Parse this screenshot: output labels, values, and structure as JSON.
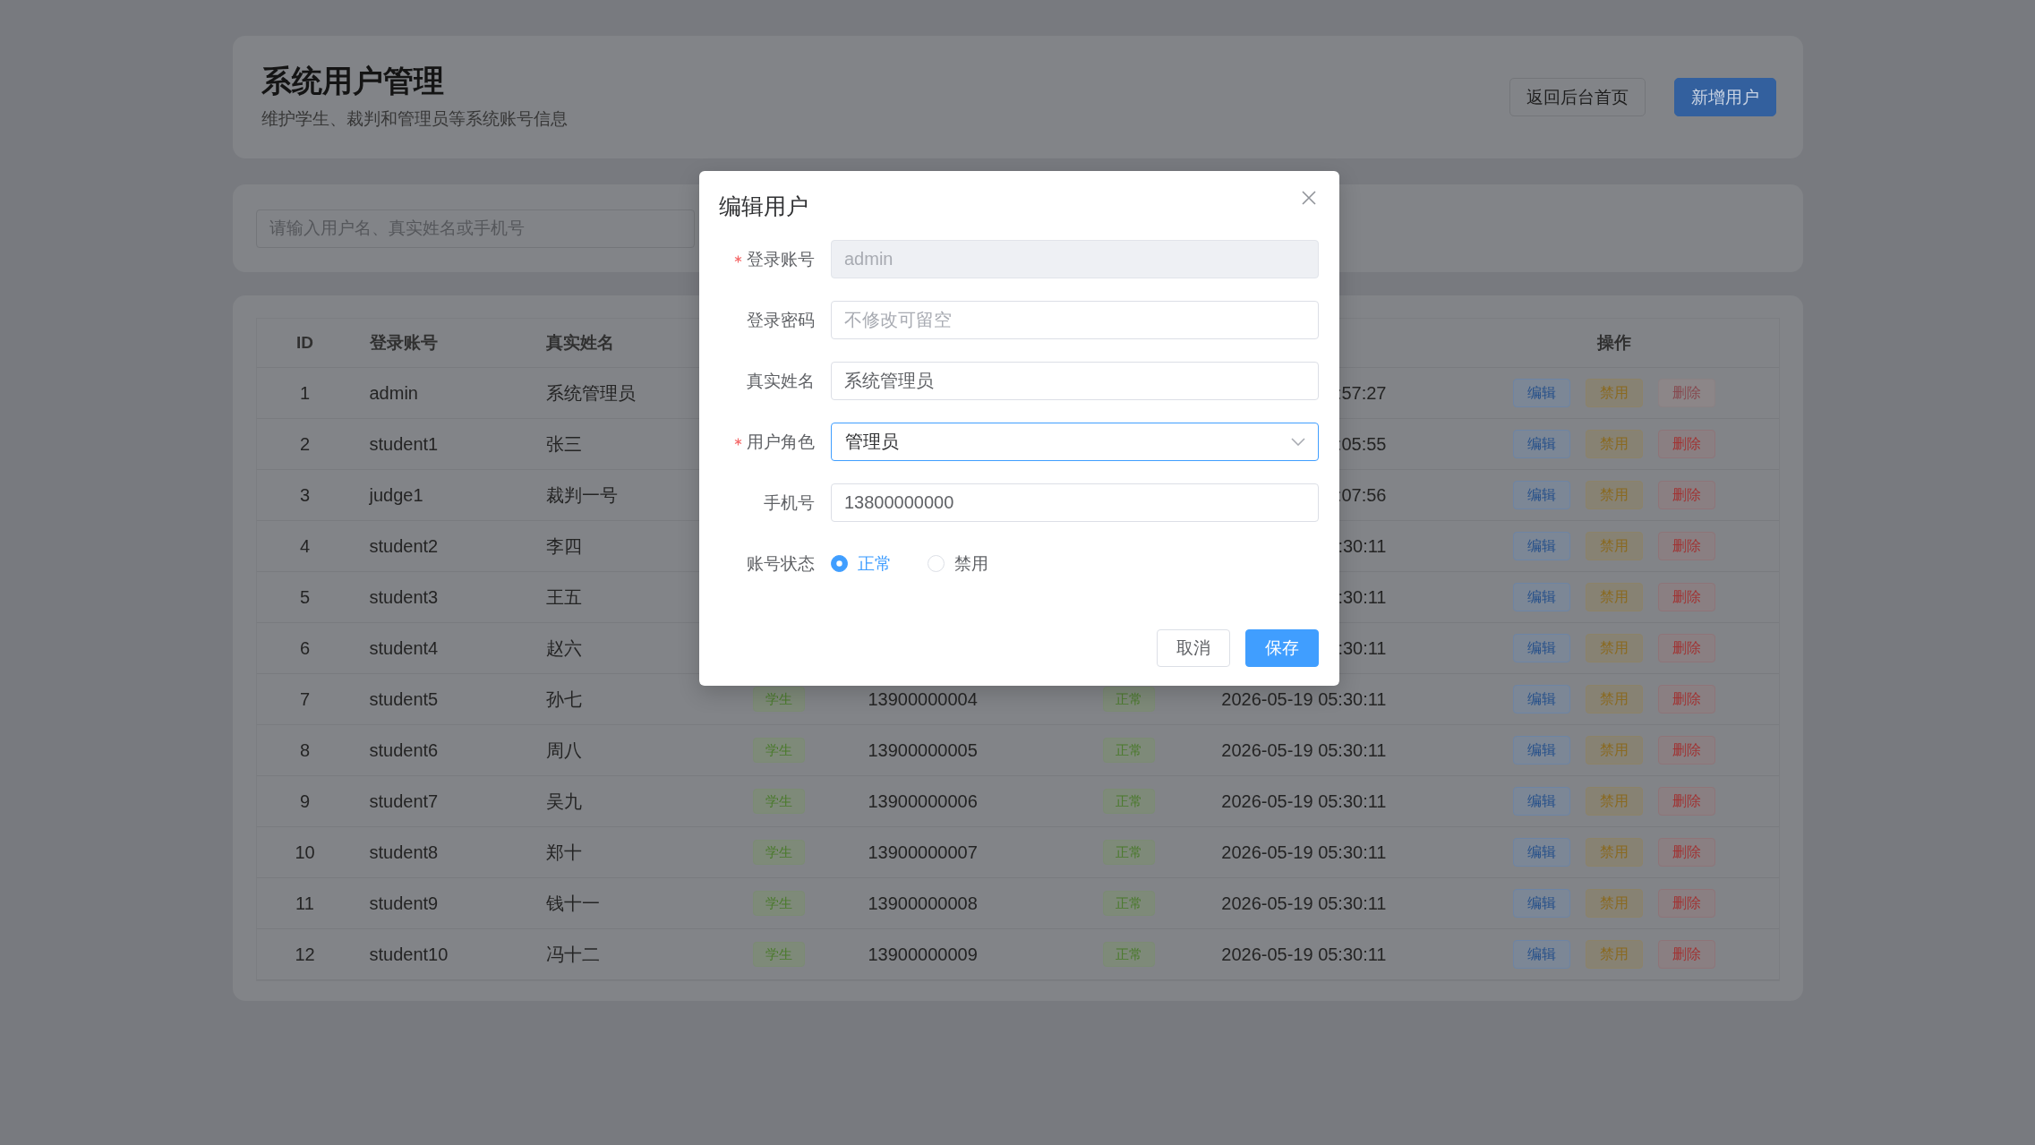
{
  "header": {
    "title": "系统用户管理",
    "subtitle": "维护学生、裁判和管理员等系统账号信息",
    "buttons": [
      {
        "label": "返回后台首页",
        "kind": "back"
      },
      {
        "label": "新增用户",
        "kind": "add"
      }
    ]
  },
  "search": {
    "placeholder": "请输入用户名、真实姓名或手机号"
  },
  "table": {
    "columns": {
      "id": "ID",
      "account": "登录账号",
      "real_name": "真实姓名",
      "actions": "操作"
    },
    "rows": [
      {
        "id": "1",
        "account": "admin",
        "real_name": "系统管理员",
        "column_7": ":57:27",
        "actions": [
          {
            "label": "编辑",
            "kind": "edit",
            "disabled": false
          },
          {
            "label": "禁用",
            "kind": "disable",
            "disabled": false
          },
          {
            "label": "删除",
            "kind": "delete",
            "disabled": true
          }
        ]
      },
      {
        "id": "2",
        "account": "student1",
        "real_name": "张三",
        "column_7": ":05:55",
        "actions": [
          {
            "label": "编辑",
            "kind": "edit",
            "disabled": false
          },
          {
            "label": "禁用",
            "kind": "disable",
            "disabled": false
          },
          {
            "label": "删除",
            "kind": "delete",
            "disabled": false
          }
        ]
      },
      {
        "id": "3",
        "account": "judge1",
        "real_name": "裁判一号",
        "column_7": ":07:56",
        "actions": [
          {
            "label": "编辑",
            "kind": "edit",
            "disabled": false
          },
          {
            "label": "禁用",
            "kind": "disable",
            "disabled": false
          },
          {
            "label": "删除",
            "kind": "delete",
            "disabled": false
          }
        ]
      },
      {
        "id": "4",
        "account": "student2",
        "real_name": "李四",
        "column_7": ":30:11",
        "actions": [
          {
            "label": "编辑",
            "kind": "edit",
            "disabled": false
          },
          {
            "label": "禁用",
            "kind": "disable",
            "disabled": false
          },
          {
            "label": "删除",
            "kind": "delete",
            "disabled": false
          }
        ]
      },
      {
        "id": "5",
        "account": "student3",
        "real_name": "王五",
        "column_7": ":30:11",
        "actions": [
          {
            "label": "编辑",
            "kind": "edit",
            "disabled": false
          },
          {
            "label": "禁用",
            "kind": "disable",
            "disabled": false
          },
          {
            "label": "删除",
            "kind": "delete",
            "disabled": false
          }
        ]
      },
      {
        "id": "6",
        "account": "student4",
        "real_name": "赵六",
        "column_7": ":30:11",
        "actions": [
          {
            "label": "编辑",
            "kind": "edit",
            "disabled": false
          },
          {
            "label": "禁用",
            "kind": "disable",
            "disabled": false
          },
          {
            "label": "删除",
            "kind": "delete",
            "disabled": false
          }
        ]
      },
      {
        "id": "7",
        "account": "student5",
        "real_name": "孙七",
        "column_4": "学生",
        "column_5": "13900000004",
        "column_6": "正常",
        "column_7": "2026-05-19 05:30:11",
        "actions": [
          {
            "label": "编辑",
            "kind": "edit",
            "disabled": false
          },
          {
            "label": "禁用",
            "kind": "disable",
            "disabled": false
          },
          {
            "label": "删除",
            "kind": "delete",
            "disabled": false
          }
        ]
      },
      {
        "id": "8",
        "account": "student6",
        "real_name": "周八",
        "column_4": "学生",
        "column_5": "13900000005",
        "column_6": "正常",
        "column_7": "2026-05-19 05:30:11",
        "actions": [
          {
            "label": "编辑",
            "kind": "edit",
            "disabled": false
          },
          {
            "label": "禁用",
            "kind": "disable",
            "disabled": false
          },
          {
            "label": "删除",
            "kind": "delete",
            "disabled": false
          }
        ]
      },
      {
        "id": "9",
        "account": "student7",
        "real_name": "吴九",
        "column_4": "学生",
        "column_5": "13900000006",
        "column_6": "正常",
        "column_7": "2026-05-19 05:30:11",
        "actions": [
          {
            "label": "编辑",
            "kind": "edit",
            "disabled": false
          },
          {
            "label": "禁用",
            "kind": "disable",
            "disabled": false
          },
          {
            "label": "删除",
            "kind": "delete",
            "disabled": false
          }
        ]
      },
      {
        "id": "10",
        "account": "student8",
        "real_name": "郑十",
        "column_4": "学生",
        "column_5": "13900000007",
        "column_6": "正常",
        "column_7": "2026-05-19 05:30:11",
        "actions": [
          {
            "label": "编辑",
            "kind": "edit",
            "disabled": false
          },
          {
            "label": "禁用",
            "kind": "disable",
            "disabled": false
          },
          {
            "label": "删除",
            "kind": "delete",
            "disabled": false
          }
        ]
      },
      {
        "id": "11",
        "account": "student9",
        "real_name": "钱十一",
        "column_4": "学生",
        "column_5": "13900000008",
        "column_6": "正常",
        "column_7": "2026-05-19 05:30:11",
        "actions": [
          {
            "label": "编辑",
            "kind": "edit",
            "disabled": false
          },
          {
            "label": "禁用",
            "kind": "disable",
            "disabled": false
          },
          {
            "label": "删除",
            "kind": "delete",
            "disabled": false
          }
        ]
      },
      {
        "id": "12",
        "account": "student10",
        "real_name": "冯十二",
        "column_4": "学生",
        "column_5": "13900000009",
        "column_6": "正常",
        "column_7": "2026-05-19 05:30:11",
        "actions": [
          {
            "label": "编辑",
            "kind": "edit",
            "disabled": false
          },
          {
            "label": "禁用",
            "kind": "disable",
            "disabled": false
          },
          {
            "label": "删除",
            "kind": "delete",
            "disabled": false
          }
        ]
      }
    ]
  },
  "dialog": {
    "title": "编辑用户",
    "fields": [
      {
        "label": "登录账号",
        "required": true,
        "kind": "input",
        "value": "admin",
        "disabled": true,
        "focused": false
      },
      {
        "label": "登录密码",
        "required": false,
        "kind": "input",
        "placeholder": "不修改可留空",
        "disabled": false,
        "focused": false
      },
      {
        "label": "真实姓名",
        "required": false,
        "kind": "input",
        "value": "系统管理员",
        "disabled": false,
        "focused": false
      },
      {
        "label": "用户角色",
        "required": true,
        "kind": "select",
        "value": "管理员",
        "disabled": false,
        "focused": true
      },
      {
        "label": "手机号",
        "required": false,
        "kind": "input",
        "value": "13800000000",
        "disabled": false,
        "focused": false
      },
      {
        "label": "账号状态",
        "required": false,
        "kind": "radio",
        "options": [
          {
            "label": "正常",
            "selected": true
          },
          {
            "label": "禁用",
            "selected": false
          }
        ]
      }
    ],
    "buttons": [
      {
        "label": "取消",
        "kind": "cancel"
      },
      {
        "label": "保存",
        "kind": "save"
      }
    ]
  }
}
